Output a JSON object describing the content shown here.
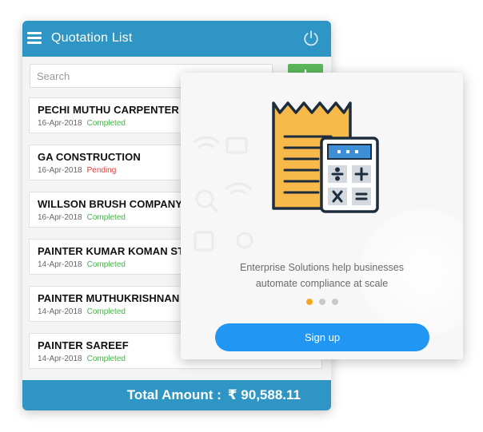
{
  "app": {
    "title": "Quotation List",
    "search_placeholder": "Search",
    "add_label": "+"
  },
  "quotations": [
    {
      "name": "PECHI MUTHU CARPENTER",
      "date": "16-Apr-2018",
      "status": "Completed"
    },
    {
      "name": "GA CONSTRUCTION",
      "date": "16-Apr-2018",
      "status": "Pending"
    },
    {
      "name": "WILLSON BRUSH COMPANY",
      "date": "16-Apr-2018",
      "status": "Completed"
    },
    {
      "name": "PAINTER KUMAR KOMAN ST",
      "date": "14-Apr-2018",
      "status": "Completed"
    },
    {
      "name": "PAINTER MUTHUKRISHNAN",
      "date": "14-Apr-2018",
      "status": "Completed"
    },
    {
      "name": "PAINTER SAREEF",
      "date": "14-Apr-2018",
      "status": "Completed"
    }
  ],
  "total": {
    "label": "Total Amount :",
    "value": "₹ 90,588.11"
  },
  "overlay": {
    "tagline_line1": "Enterprise Solutions help businesses",
    "tagline_line2": "automate compliance at scale",
    "signup_label": "Sign up",
    "pages": 3,
    "active_page": 1
  },
  "icons": {
    "menu": "hamburger-menu-icon",
    "power": "power-icon",
    "add": "plus-icon",
    "illustration": "receipt-calculator-illustration"
  },
  "colors": {
    "primary": "#2f95c4",
    "add_button": "#5cb85c",
    "completed": "#4caf50",
    "pending": "#e53935",
    "signup": "#2196f3",
    "active_dot": "#f5a623"
  }
}
